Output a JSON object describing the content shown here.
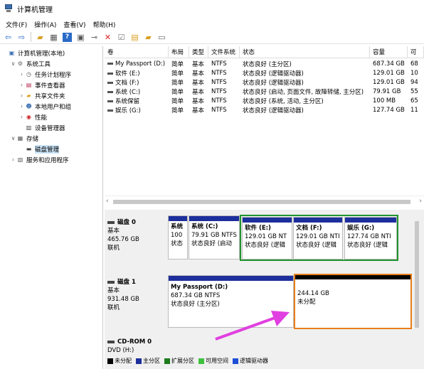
{
  "window": {
    "title": "计算机管理"
  },
  "menu": [
    "文件(F)",
    "操作(A)",
    "查看(V)",
    "帮助(H)"
  ],
  "toolbar_icons": [
    "back-arrow-icon",
    "forward-arrow-icon",
    "up-folder-icon",
    "show-tree-icon",
    "help-icon",
    "console-icon",
    "connect-icon",
    "delete-icon",
    "properties-icon",
    "open-icon",
    "folder-icon",
    "list-icon"
  ],
  "tree": [
    {
      "label": "计算机管理(本地)",
      "depth": 0,
      "twisty": "",
      "icon": "computer-icon"
    },
    {
      "label": "系统工具",
      "depth": 1,
      "twisty": "∨",
      "icon": "tools-icon"
    },
    {
      "label": "任务计划程序",
      "depth": 2,
      "twisty": "›",
      "icon": "clock-icon"
    },
    {
      "label": "事件查看器",
      "depth": 2,
      "twisty": "›",
      "icon": "event-viewer-icon"
    },
    {
      "label": "共享文件夹",
      "depth": 2,
      "twisty": "›",
      "icon": "shared-folder-icon"
    },
    {
      "label": "本地用户和组",
      "depth": 2,
      "twisty": "›",
      "icon": "users-icon"
    },
    {
      "label": "性能",
      "depth": 2,
      "twisty": "›",
      "icon": "performance-icon"
    },
    {
      "label": "设备管理器",
      "depth": 2,
      "twisty": "",
      "icon": "device-manager-icon"
    },
    {
      "label": "存储",
      "depth": 1,
      "twisty": "∨",
      "icon": "storage-icon"
    },
    {
      "label": "磁盘管理",
      "depth": 2,
      "twisty": "",
      "icon": "disk-management-icon",
      "selected": true
    },
    {
      "label": "服务和应用程序",
      "depth": 1,
      "twisty": "›",
      "icon": "services-icon"
    }
  ],
  "volume_table": {
    "headers": [
      "卷",
      "布局",
      "类型",
      "文件系统",
      "状态",
      "容量",
      "可"
    ],
    "rows": [
      [
        "My Passport (D:)",
        "简单",
        "基本",
        "NTFS",
        "状态良好 (主分区)",
        "687.34 GB",
        "68"
      ],
      [
        "软件 (E:)",
        "简单",
        "基本",
        "NTFS",
        "状态良好 (逻辑驱动器)",
        "129.01 GB",
        "10"
      ],
      [
        "文档 (F:)",
        "简单",
        "基本",
        "NTFS",
        "状态良好 (逻辑驱动器)",
        "129.01 GB",
        "94"
      ],
      [
        "系统 (C:)",
        "简单",
        "基本",
        "NTFS",
        "状态良好 (启动, 页面文件, 故障转储, 主分区)",
        "79.91 GB",
        "55"
      ],
      [
        "系统保留",
        "简单",
        "基本",
        "NTFS",
        "状态良好 (系统, 活动, 主分区)",
        "100 MB",
        "65"
      ],
      [
        "娱乐 (G:)",
        "简单",
        "基本",
        "NTFS",
        "状态良好 (逻辑驱动器)",
        "127.74 GB",
        "11"
      ]
    ]
  },
  "disks": [
    {
      "name": "磁盘 0",
      "type": "基本",
      "size": "465.76 GB",
      "status": "联机",
      "partitions": [
        {
          "title": "系统",
          "size": "100",
          "status": "状态"
        },
        {
          "title": "系统 (C:)",
          "size": "79.91 GB NTFS",
          "status": "状态良好 (启动"
        },
        {
          "title": "软件 (E:)",
          "size": "129.01 GB NT",
          "status": "状态良好 (逻辑"
        },
        {
          "title": "文档 (F:)",
          "size": "129.01 GB NTI",
          "status": "状态良好 (逻辑"
        },
        {
          "title": "娱乐 (G:)",
          "size": "127.74 GB NTI",
          "status": "状态良好 (逻辑"
        }
      ]
    },
    {
      "name": "磁盘 1",
      "type": "基本",
      "size": "931.48 GB",
      "status": "联机",
      "partitions": [
        {
          "title": "My Passport (D:)",
          "size": "687.34 GB NTFS",
          "status": "状态良好 (主分区)"
        },
        {
          "title": "",
          "size": "244.14 GB",
          "status": "未分配"
        }
      ]
    },
    {
      "name": "CD-ROM 0",
      "type": "DVD (H:)"
    }
  ],
  "legend": [
    {
      "label": "未分配",
      "color": "#000000"
    },
    {
      "label": "主分区",
      "color": "#1d2f9c"
    },
    {
      "label": "扩展分区",
      "color": "#1e7b1e"
    },
    {
      "label": "可用空间",
      "color": "#3ec23e"
    },
    {
      "label": "逻辑驱动器",
      "color": "#1d4ed8"
    }
  ],
  "colors": {
    "primary_bar": "#1d2f9c",
    "unallocated_bar": "#000000",
    "highlight_green": "#21932e",
    "highlight_orange": "#e87e1a",
    "arrow": "#e040e0"
  }
}
